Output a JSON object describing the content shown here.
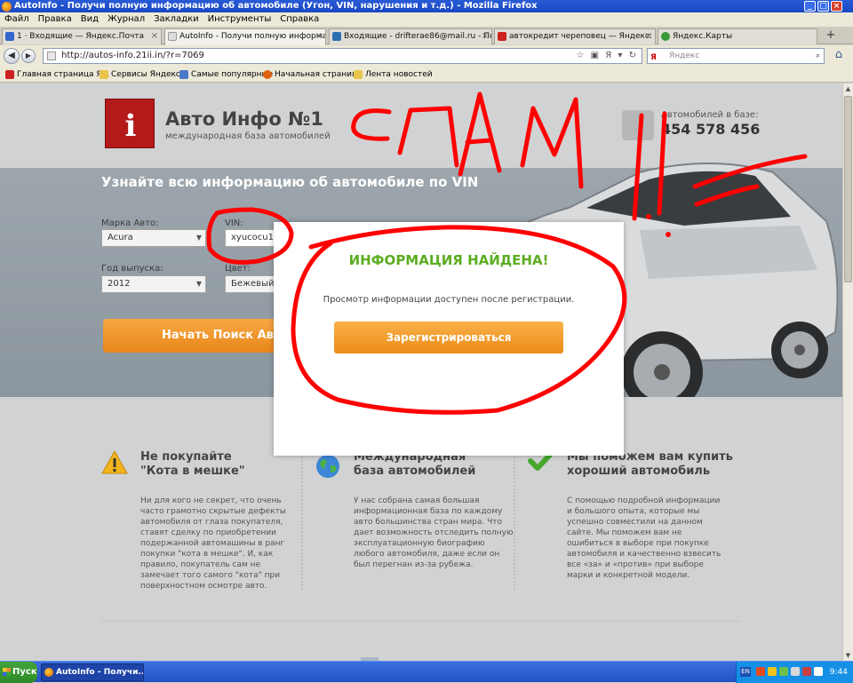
{
  "window": {
    "title": "AutoInfo - Получи полную информацию об автомобиле (Угон, VIN, нарушения и т.д.) - Mozilla Firefox"
  },
  "menu": [
    "Файл",
    "Правка",
    "Вид",
    "Журнал",
    "Закладки",
    "Инструменты",
    "Справка"
  ],
  "tabs": [
    {
      "label": "1 · Входящие — Яндекс.Почта",
      "color": "#3366cc"
    },
    {
      "label": "AutoInfo - Получи полную информаци...",
      "color": "#dddddd"
    },
    {
      "label": "Входящие - drifterae86@mail.ru - Почт...",
      "color": "#2b6fb0"
    },
    {
      "label": "автокредит череповец — Яндекс: На...",
      "color": "#cc2222"
    },
    {
      "label": "Яндекс.Карты",
      "color": "#3a9a3a"
    }
  ],
  "nav": {
    "url": "http://autos-info.21ii.in/?r=7069",
    "search_placeholder": "Яндекс",
    "search_brand": "Я"
  },
  "bookmarks": [
    {
      "label": "Главная страница Я...",
      "color": "#cc2222"
    },
    {
      "label": "Сервисы Яндекса",
      "color": "#e8c44a"
    },
    {
      "label": "Самые популярные",
      "color": "#4a78c8"
    },
    {
      "label": "Начальная страница",
      "color": "#e2600d"
    },
    {
      "label": "Лента новостей",
      "color": "#e8c44a"
    }
  ],
  "site": {
    "title": "Авто Инфо №1",
    "subtitle": "международная база автомобилей",
    "db_label": "Автомобилей в базе:",
    "db_count": "454 578 456",
    "vin_title": "Узнайте всю информацию об автомобиле по VIN",
    "brand_label": "Марка Авто:",
    "brand_value": "Acura",
    "vin_label": "VIN:",
    "vin_value": "xyucocu14",
    "year_label": "Год выпуска:",
    "year_value": "2012",
    "color_label": "Цвет:",
    "color_value": "Бежевый",
    "start_button": "Начать Поиск Авто"
  },
  "modal": {
    "title": "ИНФОРМАЦИЯ НАЙДЕНА!",
    "text": "Просмотр информации доступен после регистрации.",
    "button": "Зарегистрироваться"
  },
  "features": [
    {
      "title1": "Не покупайте",
      "title2": "\"Кота в мешке\"",
      "lines": [
        "Ни для кого не секрет, что очень",
        "часто грамотно скрытые дефекты",
        "автомобиля от глаза покупателя,",
        "ставят сделку по приобретении",
        "подержанной автомашины в ранг",
        "покупки \"кота в мешке\". И, как",
        "правило, покупатель сам не",
        "замечает того самого \"кота\" при",
        "поверхностном осмотре авто."
      ]
    },
    {
      "title1": "Международная",
      "title2": "база автомобилей",
      "lines": [
        "У нас собрана самая большая",
        "информационная база по каждому",
        "авто большинства стран мира. Что",
        "дает возможность отследить полную",
        "эксплуатационную биографию",
        "любого автомобиля, даже если он",
        "был перегнан из-за рубежа."
      ]
    },
    {
      "title1": "Мы поможем вам купить",
      "title2": "хороший автомобиль",
      "lines": [
        "С помощью подробной информации",
        "и большого опыта, которые мы",
        "успешно совместили на данном",
        "сайте. Мы поможем вам не",
        "ошибиться в выборе при покупке",
        "автомобиля и качественно взвесить",
        "все «за» и «против» при выборе",
        "марки и конкретной модели."
      ]
    }
  ],
  "annotation": {
    "text": "СПАМ!!",
    "color": "#ff0000"
  },
  "taskbar": {
    "start": "Пуск",
    "item": "AutoInfo - Получи...",
    "lang": "EN",
    "time": "9:44"
  }
}
